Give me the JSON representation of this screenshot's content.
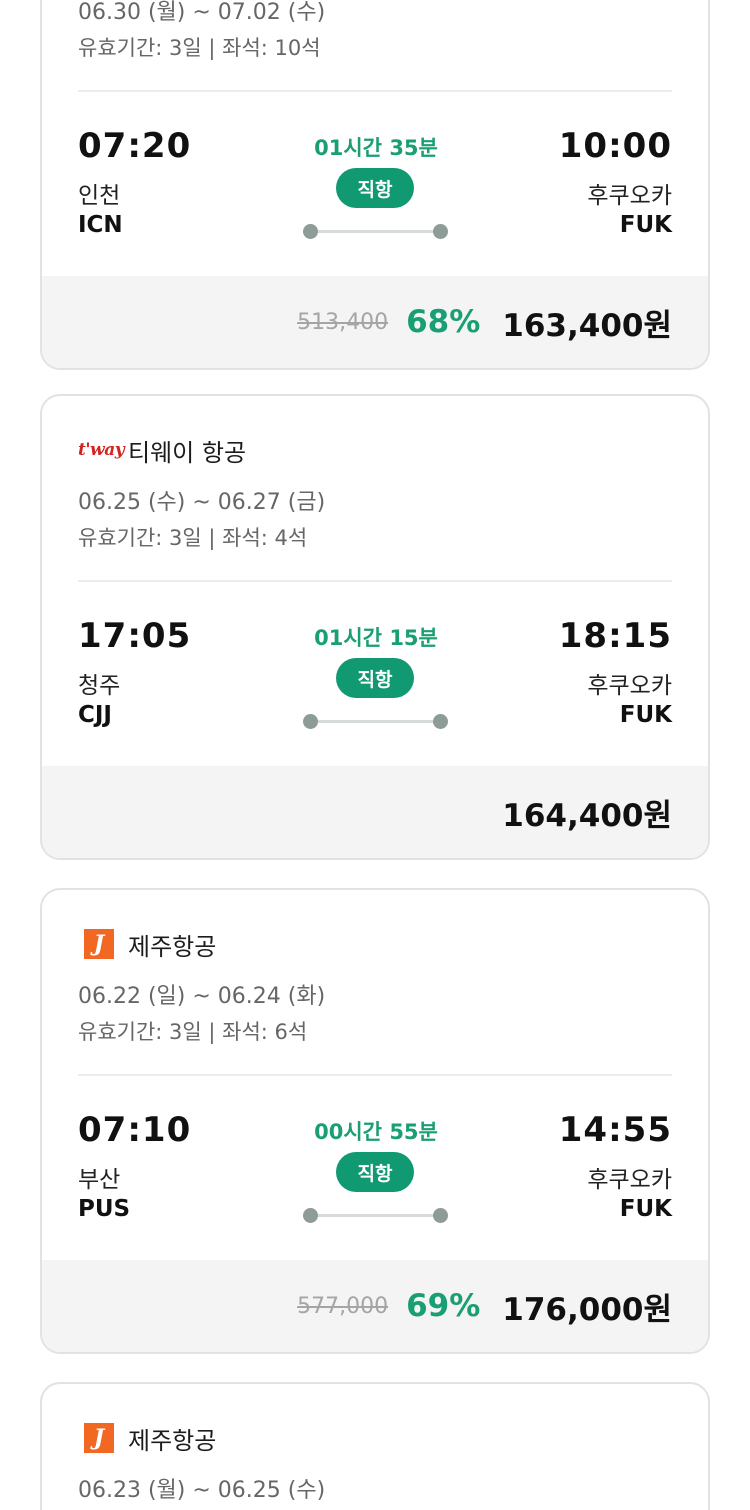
{
  "cards": [
    {
      "dates": "06.30 (월) ~ 07.02 (수)",
      "validity": "유효기간: 3일 | 좌석: 10석",
      "dep_time": "07:20",
      "dep_city": "인천",
      "dep_code": "ICN",
      "arr_time": "10:00",
      "arr_city": "후쿠오카",
      "arr_code": "FUK",
      "duration": "01시간 35분",
      "direct": "직항",
      "orig_price": "513,400",
      "discount": "68%",
      "price": "163,400원"
    },
    {
      "airline_logo": "t'way",
      "airline": "티웨이 항공",
      "dates": "06.25 (수) ~ 06.27 (금)",
      "validity": "유효기간: 3일 | 좌석: 4석",
      "dep_time": "17:05",
      "dep_city": "청주",
      "dep_code": "CJJ",
      "arr_time": "18:15",
      "arr_city": "후쿠오카",
      "arr_code": "FUK",
      "duration": "01시간 15분",
      "direct": "직항",
      "price": "164,400원"
    },
    {
      "airline_logo": "J",
      "airline": "제주항공",
      "dates": "06.22 (일) ~ 06.24 (화)",
      "validity": "유효기간: 3일 | 좌석: 6석",
      "dep_time": "07:10",
      "dep_city": "부산",
      "dep_code": "PUS",
      "arr_time": "14:55",
      "arr_city": "후쿠오카",
      "arr_code": "FUK",
      "duration": "00시간 55분",
      "direct": "직항",
      "orig_price": "577,000",
      "discount": "69%",
      "price": "176,000원"
    },
    {
      "airline_logo": "J",
      "airline": "제주항공",
      "dates": "06.23 (월) ~ 06.25 (수)"
    }
  ],
  "colors": {
    "accent": "#119972",
    "accent_text": "#1a9e74",
    "tway_red": "#d3231f",
    "jeju_orange": "#f26722"
  }
}
